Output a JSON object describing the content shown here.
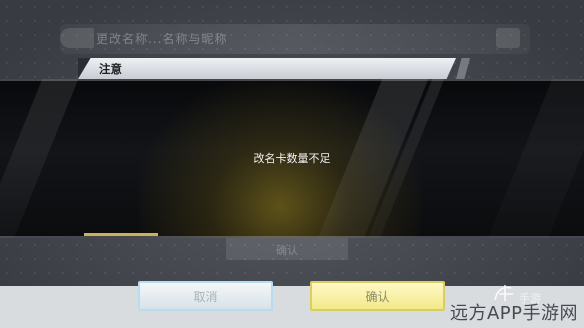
{
  "dialog": {
    "title": "注意",
    "message": "改名卡数量不足"
  },
  "buttons": {
    "cancel_label": "取消",
    "confirm_label": "确认"
  },
  "background": {
    "faded_title": "更改名称...名称与昵称",
    "faded_button_label": "确认"
  },
  "watermark": {
    "text": "远方APP手游网",
    "seal_text": "手游"
  },
  "colors": {
    "header_bg": "#e4e6ea",
    "band_bg": "#0b0c0e",
    "band_glow": "#78681c",
    "cancel_border": "#b8dcef",
    "confirm_bg": "#f8f1a8",
    "confirm_border": "#d8cf62"
  }
}
